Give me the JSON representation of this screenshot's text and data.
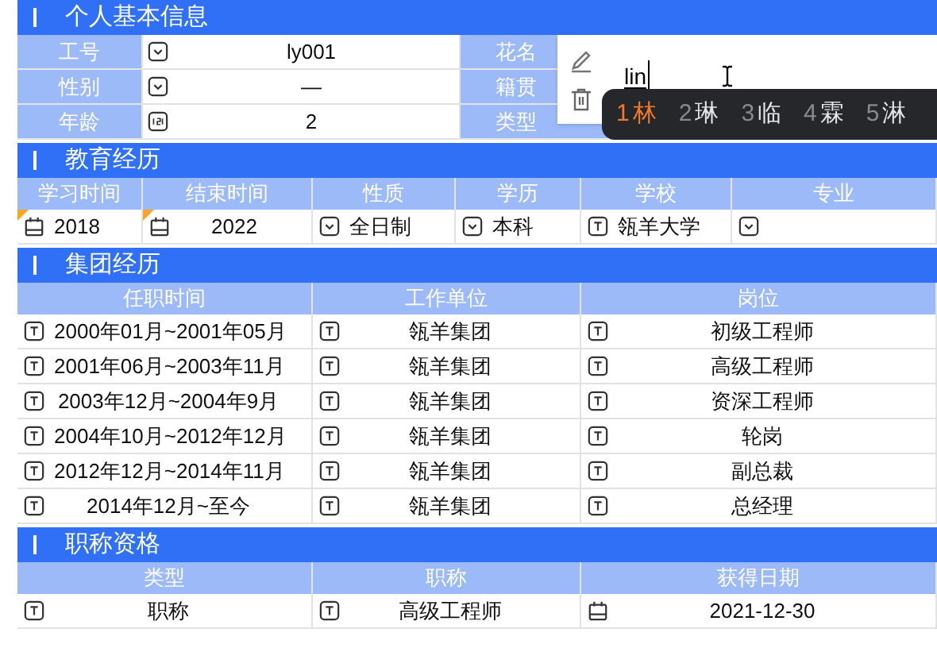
{
  "basic_info": {
    "title": "个人基本信息",
    "rows": [
      {
        "label": "工号",
        "kind": "dropdown",
        "value": "ly001"
      },
      {
        "label": "性别",
        "kind": "dropdown",
        "value": "—"
      },
      {
        "label": "年龄",
        "kind": "number",
        "value": "2"
      }
    ],
    "side_labels": [
      "花名",
      "籍贯",
      "类型"
    ]
  },
  "row_actions": [
    {
      "kind": "edit"
    },
    {
      "kind": "delete"
    }
  ],
  "name_input": {
    "value": "lin",
    "composing": true
  },
  "ime_candidates": [
    {
      "index": "1",
      "text": "林",
      "selected": true
    },
    {
      "index": "2",
      "text": "琳",
      "selected": false
    },
    {
      "index": "3",
      "text": "临",
      "selected": false
    },
    {
      "index": "4",
      "text": "霖",
      "selected": false
    },
    {
      "index": "5",
      "text": "淋",
      "selected": false
    }
  ],
  "education": {
    "title": "教育经历",
    "columns": [
      "学习时间",
      "结束时间",
      "性质",
      "学历",
      "学校",
      "专业"
    ],
    "rows": [
      [
        {
          "kind": "date",
          "text": "2018",
          "marked": true
        },
        {
          "kind": "date",
          "text": "2022",
          "marked": true
        },
        {
          "kind": "dropdown",
          "text": "全日制"
        },
        {
          "kind": "dropdown",
          "text": "本科"
        },
        {
          "kind": "text",
          "text": "瓴羊大学"
        },
        {
          "kind": "dropdown"
        }
      ]
    ]
  },
  "group_history": {
    "title": "集团经历",
    "columns": [
      "任职时间",
      "工作单位",
      "岗位"
    ],
    "rows": [
      [
        {
          "kind": "text",
          "text": "2000年01月~2001年05月"
        },
        {
          "kind": "text",
          "text": "瓴羊集团"
        },
        {
          "kind": "text",
          "text": "初级工程师"
        }
      ],
      [
        {
          "kind": "text",
          "text": "2001年06月~2003年11月"
        },
        {
          "kind": "text",
          "text": "瓴羊集团"
        },
        {
          "kind": "text",
          "text": "高级工程师"
        }
      ],
      [
        {
          "kind": "text",
          "text": "2003年12月~2004年9月"
        },
        {
          "kind": "text",
          "text": "瓴羊集团"
        },
        {
          "kind": "text",
          "text": "资深工程师"
        }
      ],
      [
        {
          "kind": "text",
          "text": "2004年10月~2012年12月"
        },
        {
          "kind": "text",
          "text": "瓴羊集团"
        },
        {
          "kind": "text",
          "text": "轮岗"
        }
      ],
      [
        {
          "kind": "text",
          "text": "2012年12月~2014年11月"
        },
        {
          "kind": "text",
          "text": "瓴羊集团"
        },
        {
          "kind": "text",
          "text": "副总裁"
        }
      ],
      [
        {
          "kind": "text",
          "text": "2014年12月~至今"
        },
        {
          "kind": "text",
          "text": "瓴羊集团"
        },
        {
          "kind": "text",
          "text": "总经理"
        }
      ]
    ]
  },
  "qualifications": {
    "title": "职称资格",
    "columns": [
      "类型",
      "职称",
      "获得日期"
    ],
    "rows": [
      [
        {
          "kind": "text",
          "text": "职称"
        },
        {
          "kind": "text",
          "text": "高级工程师"
        },
        {
          "kind": "date",
          "text": "2021-12-30"
        }
      ]
    ]
  }
}
